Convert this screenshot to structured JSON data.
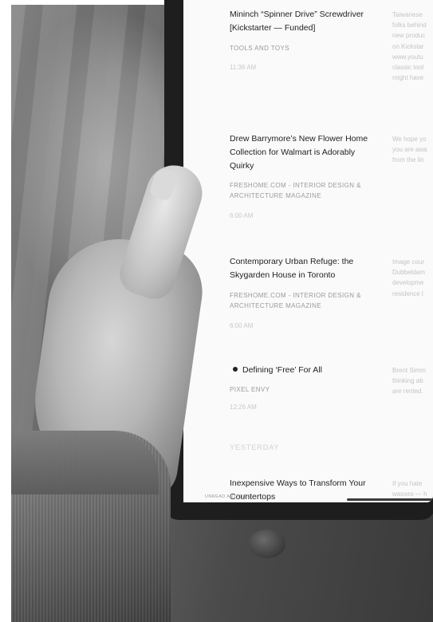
{
  "feed": {
    "items": [
      {
        "title": "Mininch “Spinner Drive” Screwdriver [Kickstarter — Funded]",
        "source": "TOOLS AND TOYS",
        "time": "11:36 AM",
        "excerpt": [
          "Taiwanese",
          "folks behind",
          "new produc",
          "on Kickstar",
          "www.youtu",
          "classic tool",
          "might have"
        ],
        "unread": false
      },
      {
        "title": "Drew Barrymore’s New Flower Home Collection for Walmart is Adorably Quirky",
        "source": "FRESHOME.COM - INTERIOR DESIGN & ARCHITECTURE MAGAZINE",
        "time": "6:00 AM",
        "excerpt": [
          "We hope yo",
          "you are awa",
          "from the lin"
        ],
        "unread": false
      },
      {
        "title": "Contemporary Urban Refuge: the Skygarden House in Toronto",
        "source": "FRESHOME.COM - INTERIOR DESIGN & ARCHITECTURE MAGAZINE",
        "time": "6:00 AM",
        "excerpt": [
          "Image cour",
          "Dubbeldam",
          "developme",
          "residence l"
        ],
        "unread": false
      },
      {
        "title": "Defining ‘Free’ For All",
        "source": "PIXEL ENVY",
        "time": "12:26 AM",
        "excerpt": [
          "Brent Simm",
          "thinking ab",
          "are rented."
        ],
        "unread": true
      }
    ],
    "section_header": "YESTERDAY",
    "last_item": {
      "title": "Inexpensive Ways to Transform Your Countertops",
      "excerpt": [
        "If you hate",
        "wasses — h"
      ]
    },
    "footer_label": "UNREAD ARTICLES"
  }
}
